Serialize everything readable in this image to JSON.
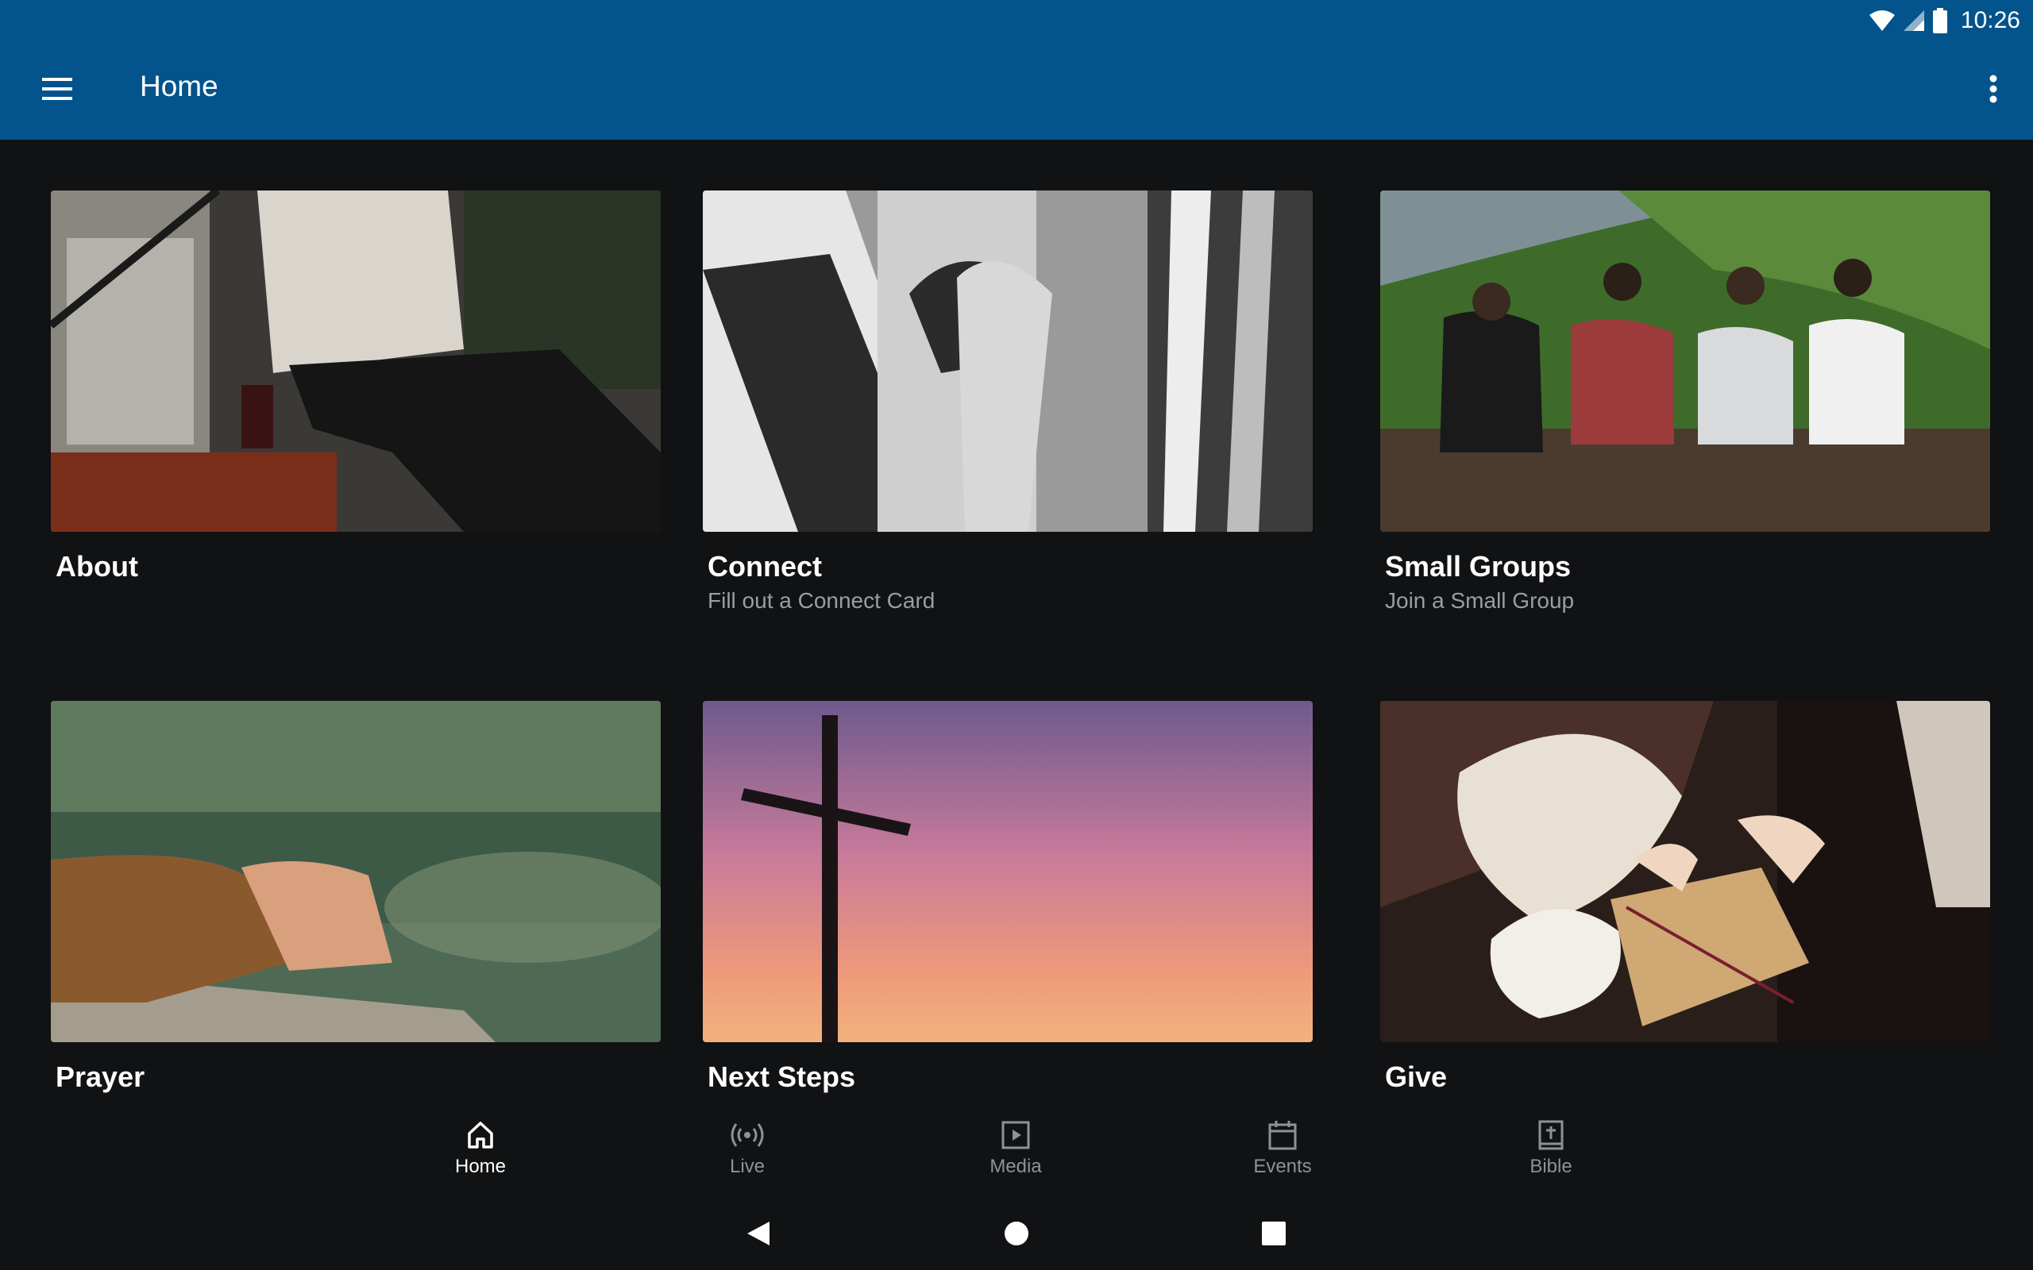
{
  "status_bar": {
    "time": "10:26",
    "icons": [
      "wifi-icon",
      "signal-icon",
      "battery-icon"
    ]
  },
  "app_bar": {
    "title": "Home",
    "menu_icon": "hamburger-menu-icon",
    "overflow_icon": "more-vert-icon"
  },
  "colors": {
    "app_bar": "#03548c",
    "background": "#111214",
    "subtitle": "#9a9ea4",
    "nav_inactive": "#8e9196"
  },
  "cards": [
    {
      "title": "About",
      "subtitle": "",
      "image": "people-sitting-coffee-photo"
    },
    {
      "title": "Connect",
      "subtitle": "Fill out a Connect Card",
      "image": "hands-holding-photo"
    },
    {
      "title": "Small Groups",
      "subtitle": "Join a Small Group",
      "image": "friends-on-hillside-photo"
    },
    {
      "title": "Prayer",
      "subtitle": "",
      "image": "hands-clasped-lake-photo"
    },
    {
      "title": "Next Steps",
      "subtitle": "",
      "image": "cross-sunset-photo"
    },
    {
      "title": "Give",
      "subtitle": "",
      "image": "wrapping-gift-photo"
    }
  ],
  "bottom_nav": [
    {
      "label": "Home",
      "icon": "home-icon",
      "active": true
    },
    {
      "label": "Live",
      "icon": "broadcast-icon",
      "active": false
    },
    {
      "label": "Media",
      "icon": "play-box-icon",
      "active": false
    },
    {
      "label": "Events",
      "icon": "calendar-icon",
      "active": false
    },
    {
      "label": "Bible",
      "icon": "bible-icon",
      "active": false
    }
  ],
  "system_nav": [
    "back-icon",
    "home-circle-icon",
    "recents-icon"
  ]
}
